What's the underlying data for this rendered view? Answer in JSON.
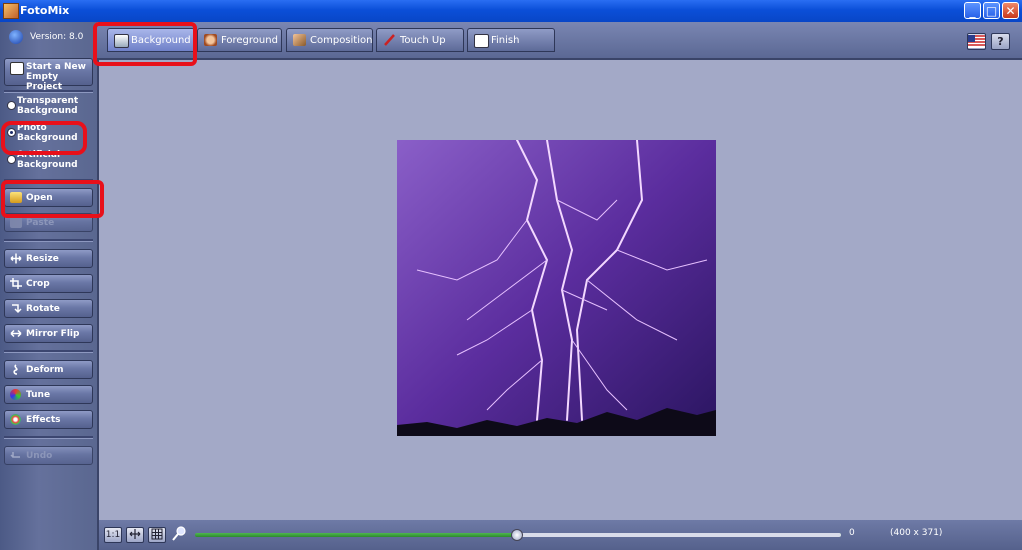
{
  "window": {
    "title": "FotoMix",
    "controls": {
      "minimize": "_",
      "maximize": "□",
      "close": "✕"
    }
  },
  "sidebar": {
    "version": "Version: 8.0",
    "new_project": "Start a New Empty Project",
    "background_options": [
      {
        "label": "Transparent Background",
        "selected": false
      },
      {
        "label": "Photo Background",
        "selected": true
      },
      {
        "label": "Artificial Background",
        "selected": false
      }
    ],
    "open": "Open",
    "paste": "Paste",
    "resize": "Resize",
    "crop": "Crop",
    "rotate": "Rotate",
    "mirror_flip": "Mirror Flip",
    "deform": "Deform",
    "tune": "Tune",
    "effects": "Effects",
    "undo": "Undo"
  },
  "tabs": [
    {
      "label": "Background",
      "active": true,
      "icon": "background-icon"
    },
    {
      "label": "Foreground",
      "active": false,
      "icon": "foreground-icon"
    },
    {
      "label": "Composition",
      "active": false,
      "icon": "composition-icon"
    },
    {
      "label": "Touch Up",
      "active": false,
      "icon": "touch-up-icon"
    },
    {
      "label": "Finish",
      "active": false,
      "icon": "finish-icon"
    }
  ],
  "top_right": {
    "help": "?"
  },
  "canvas": {
    "image": "lightning photo"
  },
  "bottom": {
    "zoom_actual": "1:1",
    "zoom_value": "0",
    "zoom_level": 0.5,
    "dimensions": "(400 x 371)"
  },
  "colors": {
    "title_bar": "#0b4fd8",
    "annotation": "#e8101a",
    "canvas_bg": "#a3a9c7"
  }
}
